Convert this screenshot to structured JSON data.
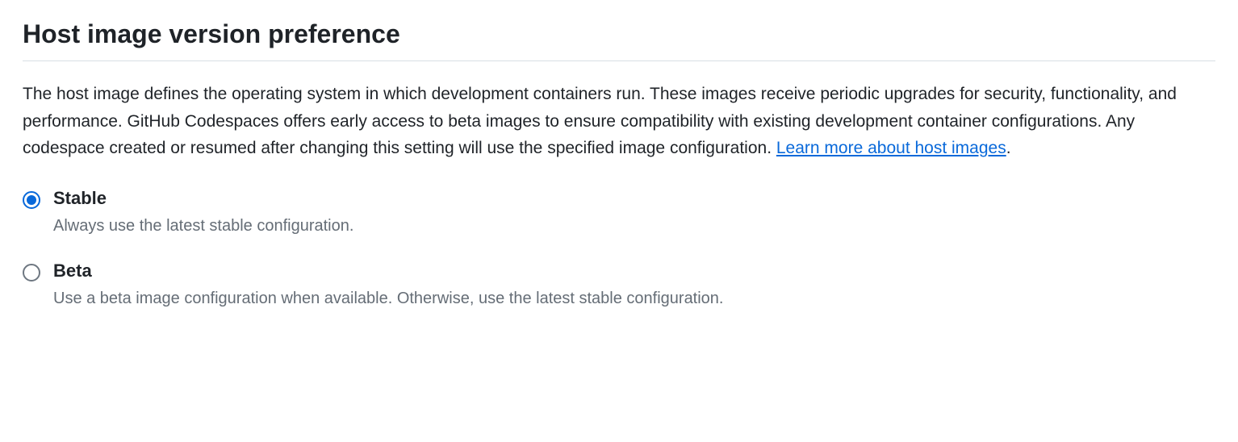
{
  "section": {
    "title": "Host image version preference",
    "description_text": "The host image defines the operating system in which development containers run. These images receive periodic upgrades for security, functionality, and performance. GitHub Codespaces offers early access to beta images to ensure compatibility with existing development container configurations. Any codespace created or resumed after changing this setting will use the specified image configuration. ",
    "link_text": "Learn more about host images",
    "period": "."
  },
  "options": {
    "stable": {
      "label": "Stable",
      "description": "Always use the latest stable configuration.",
      "checked": true
    },
    "beta": {
      "label": "Beta",
      "description": "Use a beta image configuration when available. Otherwise, use the latest stable configuration.",
      "checked": false
    }
  }
}
